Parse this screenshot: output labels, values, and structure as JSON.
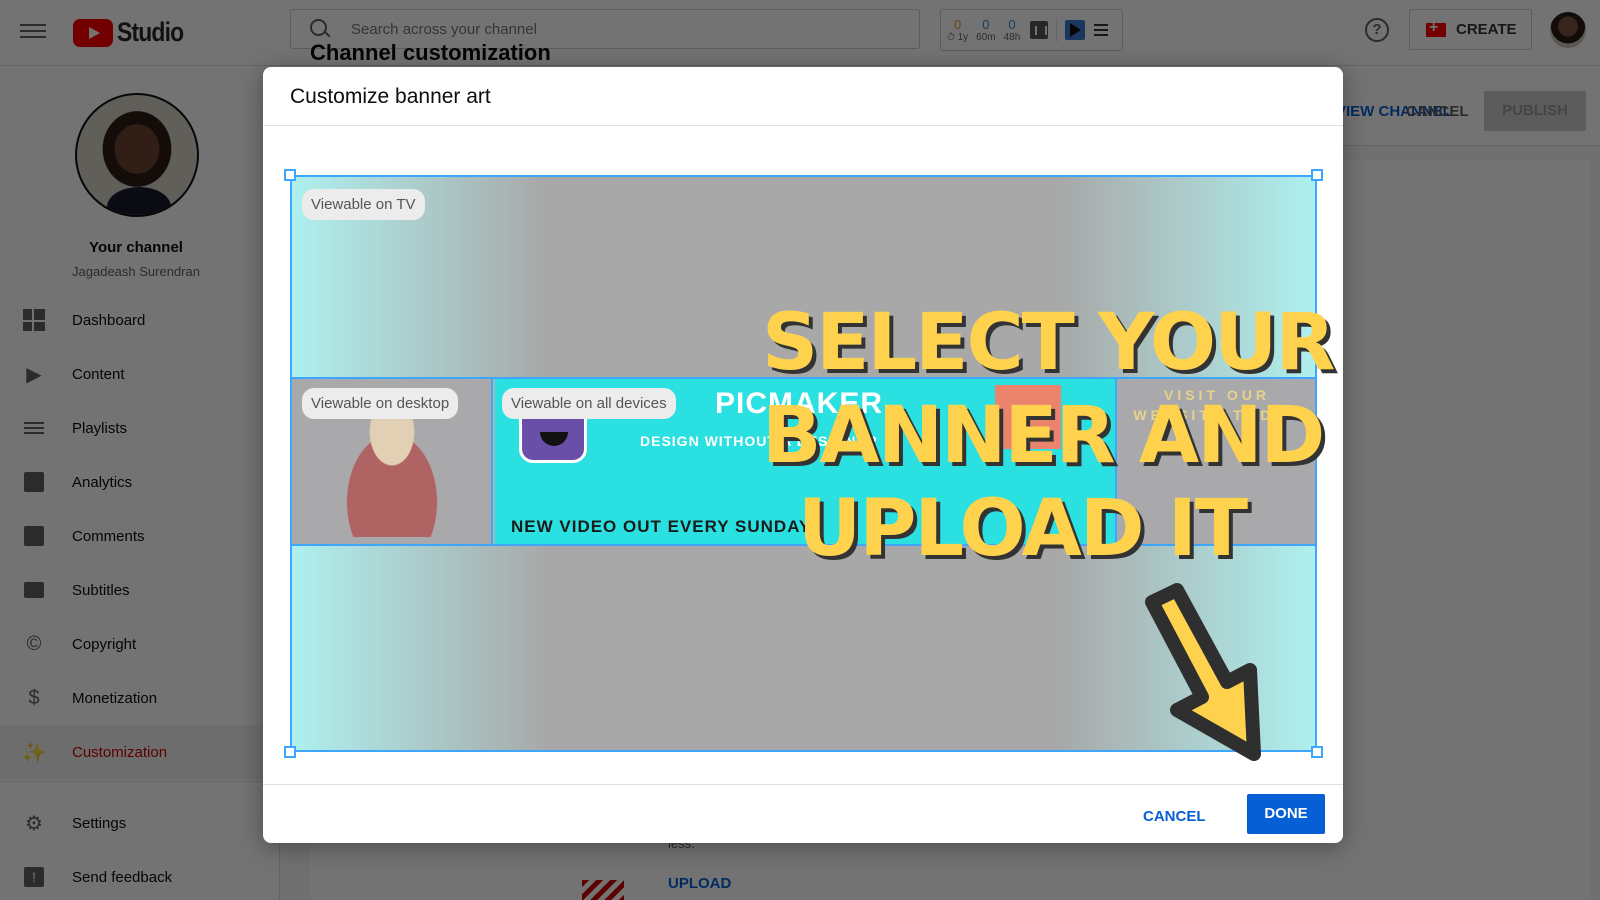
{
  "topbar": {
    "app_name": "Studio",
    "search_placeholder": "Search across your channel",
    "extension": {
      "stats": [
        {
          "value": "0",
          "label": "1y",
          "color": "#e0a030"
        },
        {
          "value": "0",
          "label": "60m",
          "color": "#3a88c8"
        },
        {
          "value": "0",
          "label": "48h",
          "color": "#3a88c8"
        }
      ]
    },
    "help_glyph": "?",
    "create_label": "CREATE"
  },
  "sidebar": {
    "channel_title": "Your channel",
    "channel_name": "Jagadeash Surendran",
    "items": [
      {
        "label": "Dashboard",
        "icon": "dashboard-icon"
      },
      {
        "label": "Content",
        "icon": "content-icon"
      },
      {
        "label": "Playlists",
        "icon": "playlists-icon"
      },
      {
        "label": "Analytics",
        "icon": "analytics-icon"
      },
      {
        "label": "Comments",
        "icon": "comments-icon"
      },
      {
        "label": "Subtitles",
        "icon": "subtitles-icon"
      },
      {
        "label": "Copyright",
        "icon": "copyright-icon"
      },
      {
        "label": "Monetization",
        "icon": "dollar-icon"
      },
      {
        "label": "Customization",
        "icon": "magic-wand-icon",
        "active": true
      }
    ],
    "bottom_items": [
      {
        "label": "Settings",
        "icon": "gear-icon"
      },
      {
        "label": "Send feedback",
        "icon": "feedback-icon"
      }
    ]
  },
  "main": {
    "heading": "Channel customization",
    "view_channel_label": "VIEW CHANNEL",
    "cancel_label": "CANCEL",
    "publish_label": "PUBLISH",
    "requirement_text": "less.",
    "upload_label": "UPLOAD"
  },
  "dialog": {
    "title": "Customize banner art",
    "zones": {
      "tv": "Viewable on TV",
      "desktop": "Viewable on desktop",
      "all_devices": "Viewable on all devices"
    },
    "banner": {
      "brand": "PICMAKER",
      "tagline": "DESIGN WITHOUT A DESIGNER",
      "subline": "NEW VIDEO OUT EVERY SUNDAY",
      "visit_text": "VISIT OUR WEBSITE TODAY"
    },
    "overlay_headline": [
      "SELECT YOUR",
      "BANNER AND",
      "UPLOAD IT"
    ],
    "cancel_label": "CANCEL",
    "done_label": "DONE"
  },
  "colors": {
    "accent_blue": "#065fd4",
    "crop_border": "#3ea6ff",
    "active_red": "#cc0000",
    "headline_yellow": "#ffd24d",
    "banner_cyan": "#2be0e0"
  }
}
